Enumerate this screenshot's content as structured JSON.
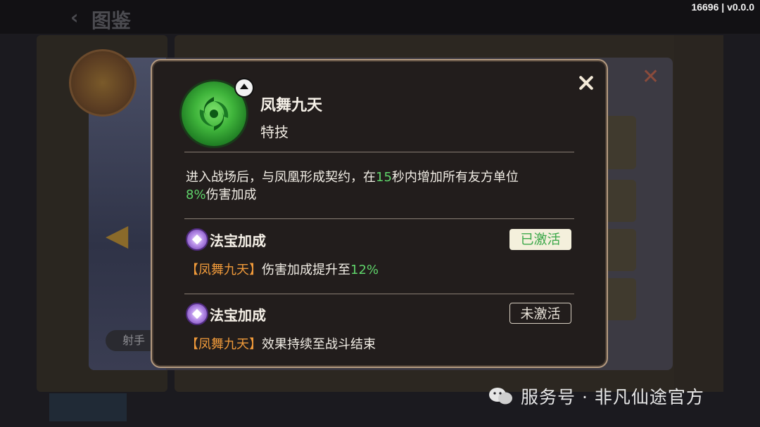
{
  "version": "16696 | v0.0.0",
  "background": {
    "page_title": "图鉴",
    "archer_label": "射手"
  },
  "popup": {
    "skill_name": "凤舞九天",
    "skill_type": "特技",
    "description": {
      "part1": "进入战场后，与凤凰形成契约，在",
      "num1": "15",
      "part2": "秒内增加所有友方单位",
      "num2": "8%",
      "part3": "伤害加成"
    },
    "bonuses": [
      {
        "title": "法宝加成",
        "status": "已激活",
        "bracket_name": "【凤舞九天】",
        "text": "伤害加成提升至",
        "value": "12%"
      },
      {
        "title": "法宝加成",
        "status": "未激活",
        "bracket_name": "【凤舞九天】",
        "text": "效果持续至战斗结束"
      }
    ]
  },
  "watermark": "服务号 · 非凡仙途官方",
  "colors": {
    "highlight_green": "#5fd36a",
    "highlight_orange": "#f09a3a",
    "popup_border": "#b49a80",
    "popup_bg": "#221d1c"
  },
  "icons": {
    "skill": "phoenix-emblem-icon",
    "expand": "caret-up-icon",
    "bonus": "magic-treasure-icon",
    "close": "close-icon"
  }
}
